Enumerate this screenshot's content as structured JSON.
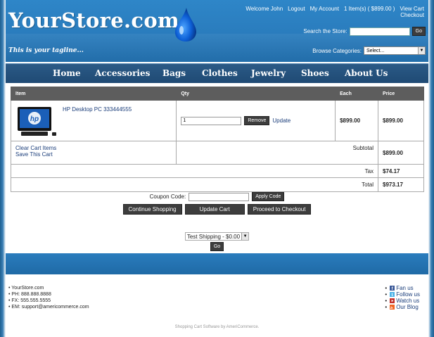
{
  "header": {
    "logo": "YourStore.com",
    "tagline": "This is your tagline...",
    "welcome": "Welcome John",
    "logout": "Logout",
    "my_account": "My Account",
    "cart_summary": "1 Item(s) ( $899.00 )",
    "view_cart": "View Cart",
    "checkout": "Checkout",
    "search_label": "Search the Store:",
    "search_value": "",
    "search_go": "Go",
    "browse_label": "Browse Categories:",
    "browse_selected": "Select..."
  },
  "nav": {
    "items": [
      "Home",
      "Accessories",
      "Bags",
      "Clothes",
      "Jewelry",
      "Shoes",
      "About Us"
    ]
  },
  "cart": {
    "headers": {
      "item": "Item",
      "qty": "Qty",
      "each": "Each",
      "price": "Price"
    },
    "items": [
      {
        "name": "HP Desktop PC 333444555",
        "qty": "1",
        "remove": "Remove",
        "update": "Update",
        "each": "$899.00",
        "price": "$899.00"
      }
    ],
    "clear_cart": "Clear Cart Items",
    "save_cart": "Save This Cart",
    "subtotal_label": "Subtotal",
    "subtotal": "$899.00",
    "tax_label": "Tax",
    "tax": "$74.17",
    "total_label": "Total",
    "total": "$973.17"
  },
  "coupon": {
    "label": "Coupon Code:",
    "value": "",
    "apply": "Apply Code"
  },
  "buttons": {
    "continue_shopping": "Continue Shopping",
    "update_cart": "Update Cart",
    "proceed_checkout": "Proceed to Checkout"
  },
  "shipping": {
    "selected": "Test Shipping - $0.00",
    "go": "Go"
  },
  "footer": {
    "contact": [
      "YourStore.com",
      "PH: 888.888.8888",
      "FX: 555.555.5555",
      "EM: support@americommerce.com"
    ],
    "social": [
      "Fan us",
      "Follow us",
      "Watch us",
      "Our Blog"
    ],
    "credit": "Shopping Cart Software by AmeriCommerce."
  },
  "colors": {
    "header_blue": "#2a7cbd",
    "nav_blue": "#2b5a86",
    "table_header": "#5d5d5d",
    "link": "#1a3d7a"
  },
  "icons": [
    "water-drop-icon",
    "desktop-pc-icon",
    "facebook-icon",
    "twitter-icon",
    "youtube-icon",
    "rss-icon",
    "chevron-down-icon"
  ]
}
